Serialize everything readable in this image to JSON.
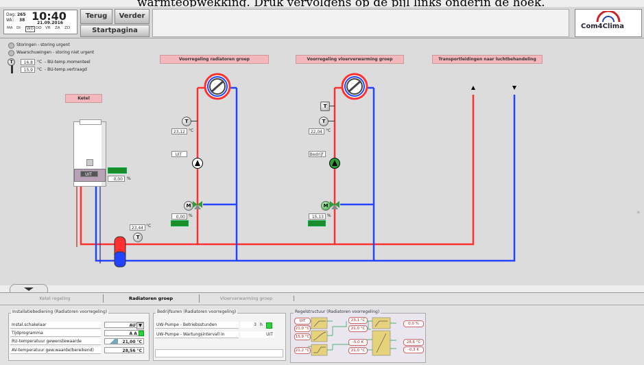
{
  "caption_fragment": "warmteopwekking. Druk vervolgens op de pijl links onderin de hoek.",
  "clock": {
    "day_label": "Dag:",
    "day_value": "265",
    "week_label": "Wk:",
    "week_value": "38",
    "time": "10:40",
    "date": "21.09.2016",
    "weekdays": [
      "MA",
      "DI",
      "WO",
      "DO",
      "VR",
      "ZA",
      "ZO"
    ],
    "active_weekday": "WO"
  },
  "nav": {
    "back": "Terug",
    "forward": "Verder",
    "home": "Startpagina"
  },
  "brand": "Com4Clima",
  "alarms": [
    "Storingen - storing urgent",
    "Waarschuwingen - storing niet urgent"
  ],
  "outdoor": [
    {
      "value": "16,8",
      "unit": "°C",
      "label": "- BU-temp.momenteel"
    },
    {
      "value": "15,9",
      "unit": "°C",
      "label": "- BU-temp.vertraagd"
    }
  ],
  "headers": {
    "radiator": "Voorregeling radiatoren groep",
    "floor": "Voorregeling vloerverwarming groep",
    "transport": "Transportleidingen naar luchtbehandeling",
    "boiler": "Ketel"
  },
  "boiler": {
    "status": "UIT",
    "percent": "0,00",
    "percent_unit": "%",
    "return_temp": "23,44",
    "temp_unit": "°C"
  },
  "radiator_group": {
    "temp": "23,12",
    "temp_unit": "°C",
    "pump_status": "UIT",
    "valve_percent": "0,00",
    "percent_unit": "%"
  },
  "floor_group": {
    "temp": "22,04",
    "temp_unit": "°C",
    "pump_status": "Bedrijf",
    "valve_percent": "15,13",
    "percent_unit": "%"
  },
  "symbols": {
    "T": "T",
    "M": "M"
  },
  "tabs": [
    "Ketel regeling",
    "Radiatoren groep",
    "Vloerverwarming groep"
  ],
  "active_tab": 1,
  "install_panel": {
    "title": "Installatiebediening (Radiatoren voorregeling)",
    "rows": [
      {
        "label": "Instal.schakelaar",
        "value": "AUTO"
      },
      {
        "label": "Tijdprogramma",
        "value": "A A N"
      },
      {
        "label": "RU-temperatuur gewenstewaarde",
        "value": "21,00",
        "unit": "°C"
      },
      {
        "label": "AV-temperatuur gew.waarde(bereikend)",
        "value": "28,56",
        "unit": "°C"
      }
    ]
  },
  "hours_panel": {
    "title": "Bedrijfsuren (Radiatoren voorregeling)",
    "rows": [
      {
        "label": "UW-Pumpe - Betriebsstunden",
        "value": "3",
        "unit": "h"
      },
      {
        "label": "UW-Pumpe - Wartungsintervall in",
        "value": "UIT"
      }
    ]
  },
  "control_panel": {
    "title": "Regelstructuur (Radiatoren voorregeling)",
    "values": [
      "UIT",
      "21,0 °C",
      "15,9 °C",
      "21,2 °C",
      "23,1 °C",
      "21,0 °C",
      "-5,0 K",
      "21,0 °C",
      "0,0 %",
      "28,6 °C",
      "-0,3 K"
    ]
  },
  "colors": {
    "supply": "#ff3030",
    "return": "#2244ff",
    "status_green": "#1c8c2a",
    "header_pink": "#f4b8bc"
  }
}
